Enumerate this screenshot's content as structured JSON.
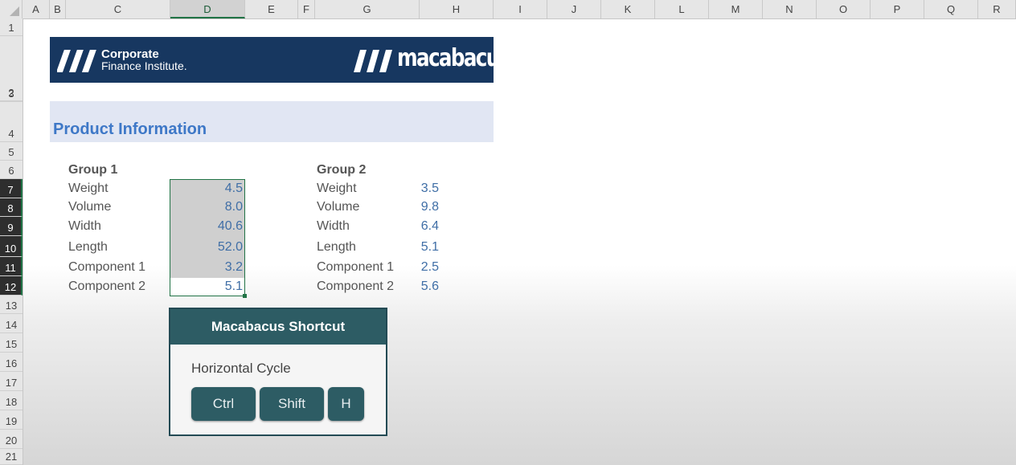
{
  "columns": [
    "A",
    "B",
    "C",
    "D",
    "E",
    "F",
    "G",
    "H",
    "I",
    "J",
    "K",
    "L",
    "M",
    "N",
    "O",
    "P",
    "Q",
    "R"
  ],
  "rows": [
    "1",
    "2",
    "3",
    "4",
    "5",
    "6",
    "7",
    "8",
    "9",
    "10",
    "11",
    "12",
    "13",
    "14",
    "15",
    "16",
    "17",
    "18",
    "19",
    "20",
    "21"
  ],
  "banner": {
    "cfi_line1": "Corporate",
    "cfi_line2": "Finance Institute.",
    "macabacus": "macabacus",
    "macabacus_tm": "™",
    "bg_color": "#173760"
  },
  "section": {
    "title": "Product Information",
    "title_color": "#3e78c7"
  },
  "group1": {
    "title": "Group 1",
    "items": [
      {
        "label": "Weight",
        "value": "4.5"
      },
      {
        "label": "Volume",
        "value": "8.0"
      },
      {
        "label": "Width",
        "value": "40.6"
      },
      {
        "label": "Length",
        "value": "52.0"
      },
      {
        "label": "Component 1",
        "value": "3.2"
      },
      {
        "label": "Component 2",
        "value": "5.1"
      }
    ]
  },
  "group2": {
    "title": "Group 2",
    "items": [
      {
        "label": "Weight",
        "value": "3.5"
      },
      {
        "label": "Volume",
        "value": "9.8"
      },
      {
        "label": "Width",
        "value": "6.4"
      },
      {
        "label": "Length",
        "value": "5.1"
      },
      {
        "label": "Component 1",
        "value": "2.5"
      },
      {
        "label": "Component 2",
        "value": "5.6"
      }
    ]
  },
  "shortcut": {
    "title": "Macabacus Shortcut",
    "description": "Horizontal Cycle",
    "keys": [
      "Ctrl",
      "Shift",
      "H"
    ],
    "color": "#2d5c64"
  }
}
